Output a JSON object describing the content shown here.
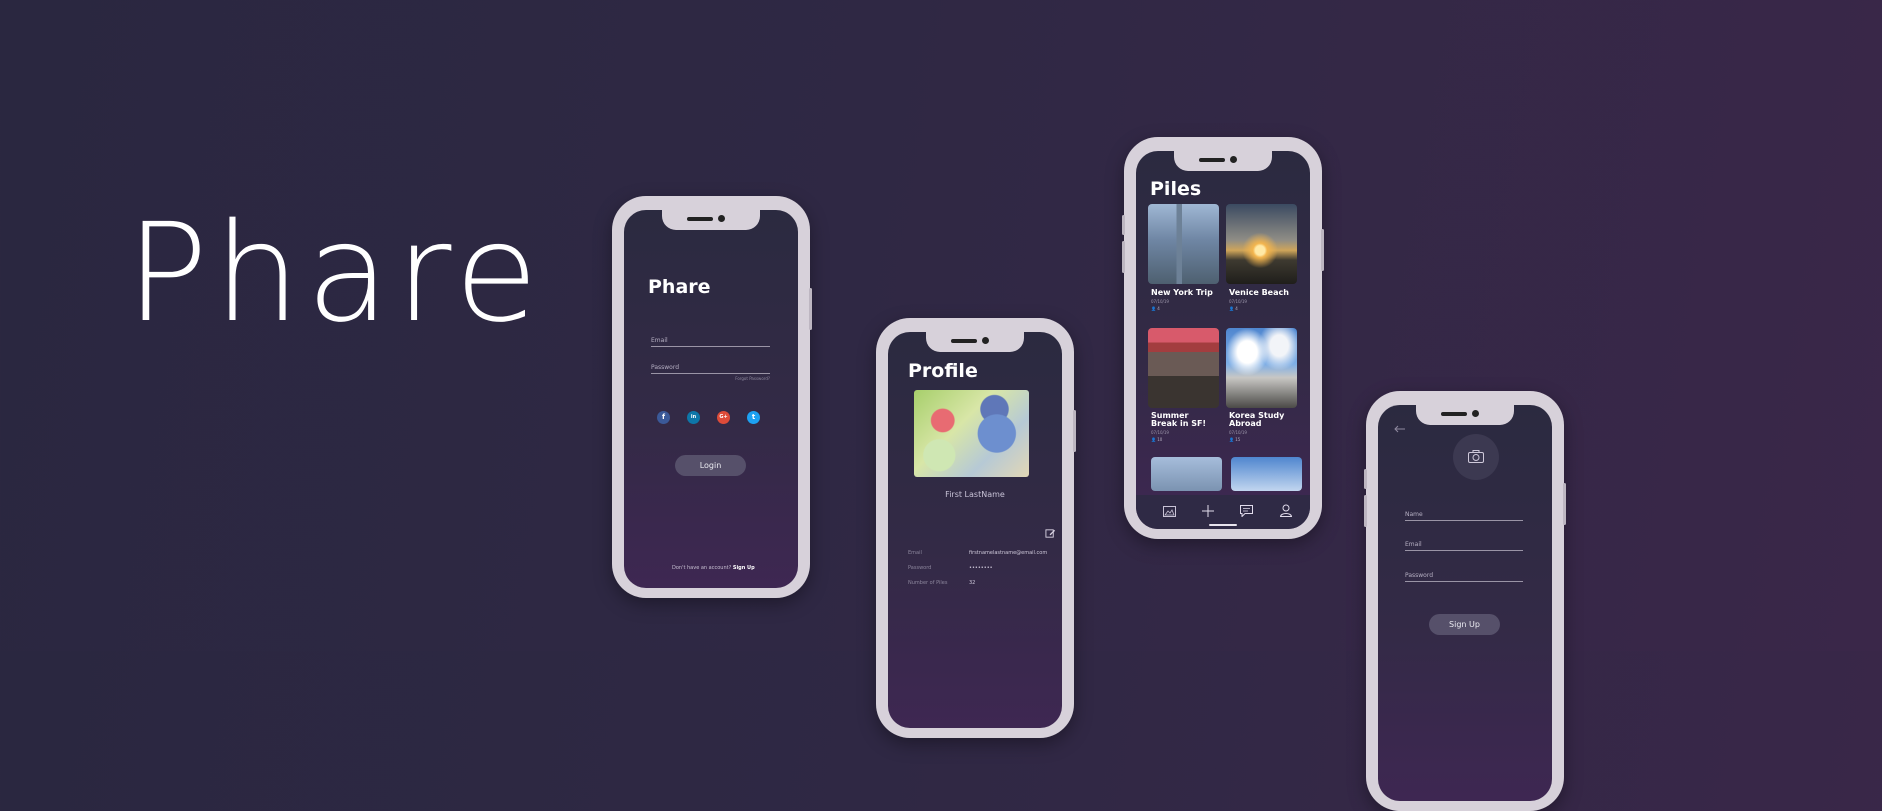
{
  "brand": {
    "title": "Phare"
  },
  "login": {
    "title": "Phare",
    "email_label": "Email",
    "password_label": "Password",
    "forgot_label": "Forgot Password?",
    "social": [
      "f",
      "in",
      "G+",
      "t"
    ],
    "login_button": "Login",
    "no_account_text": "Don't have an account?",
    "sign_up_link": "Sign Up"
  },
  "profile": {
    "title": "Profile",
    "name": "First LastName",
    "rows": [
      {
        "label": "Email",
        "value": "firstnamelastname@email.com"
      },
      {
        "label": "Password",
        "value": "••••••••"
      },
      {
        "label": "Number of Piles",
        "value": "32"
      }
    ]
  },
  "piles": {
    "title": "Piles",
    "cards": [
      {
        "title": "New York Trip",
        "date": "07/10/19",
        "count": "4"
      },
      {
        "title": "Venice Beach",
        "date": "07/10/19",
        "count": "4"
      },
      {
        "title": "Summer Break in SF!",
        "date": "07/10/19",
        "count": "10"
      },
      {
        "title": "Korea Study Abroad",
        "date": "07/10/19",
        "count": "15"
      }
    ],
    "nav_icons": [
      "image-icon",
      "plus-icon",
      "chat-icon",
      "user-icon"
    ]
  },
  "signup": {
    "name_label": "Name",
    "email_label": "Email",
    "password_label": "Password",
    "signup_button": "Sign Up"
  },
  "colors": {
    "background_start": "#2a2740",
    "background_end": "#3a2749",
    "frame": "#d7d1da",
    "pill": "#56506a",
    "facebook": "#3b5998",
    "linkedin": "#0e76a8",
    "google": "#dd4b39",
    "twitter": "#1da1f2"
  }
}
